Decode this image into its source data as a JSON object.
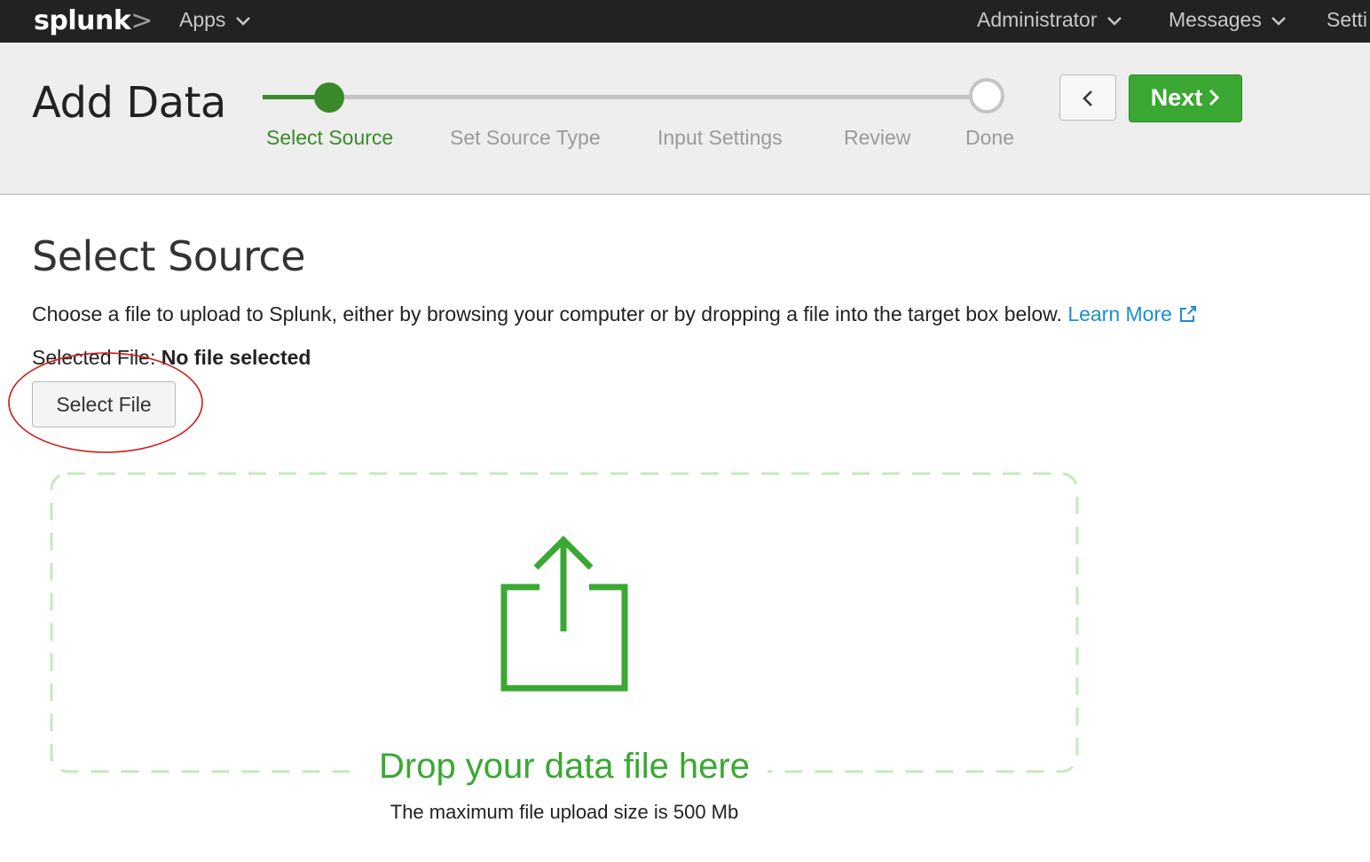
{
  "topbar": {
    "logo_text": "splunk",
    "logo_mark": ">",
    "apps_label": "Apps",
    "administrator_label": "Administrator",
    "messages_label": "Messages",
    "settings_label": "Setti"
  },
  "header": {
    "title": "Add Data",
    "steps": [
      {
        "label": "Select Source",
        "state": "active"
      },
      {
        "label": "Set Source Type",
        "state": "pending"
      },
      {
        "label": "Input Settings",
        "state": "pending"
      },
      {
        "label": "Review",
        "state": "pending"
      },
      {
        "label": "Done",
        "state": "pending"
      }
    ],
    "back_icon": "chevron-left-icon",
    "next_label": "Next"
  },
  "main": {
    "section_title": "Select Source",
    "description": "Choose a file to upload to Splunk, either by browsing your computer or by dropping a file into the target box below.",
    "learn_more": "Learn More",
    "selected_file_label": "Selected File:",
    "selected_file_value": "No file selected",
    "select_file_button": "Select File"
  },
  "dropzone": {
    "icon": "upload-icon",
    "text": "Drop your data file here",
    "max_size": "The maximum file upload size is 500 Mb"
  },
  "colors": {
    "accent_green": "#3aa832",
    "step_green": "#3a8a2a",
    "link_blue": "#1a8ed1",
    "annotation_red": "#cc1f1f",
    "topbar_bg": "#222222"
  }
}
